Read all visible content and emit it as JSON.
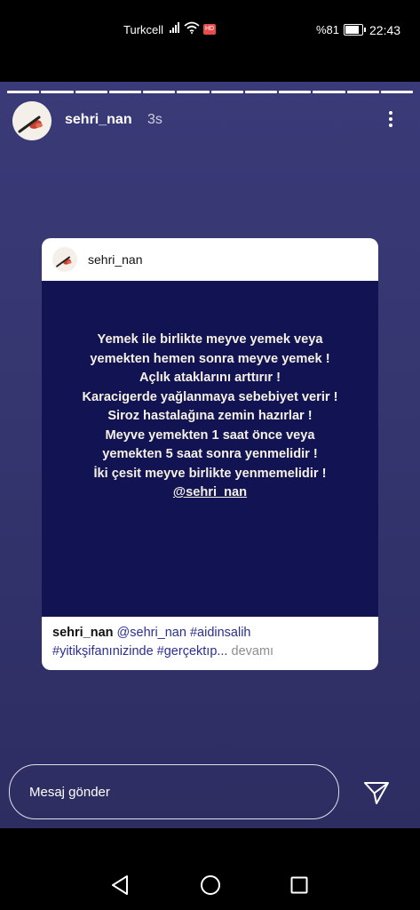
{
  "status_bar": {
    "carrier": "Turkcell",
    "hd_badge": "HD",
    "battery_percent": "%81",
    "battery_level": 0.81,
    "time": "22:43"
  },
  "story": {
    "progress_segments": 12,
    "username": "sehri_nan",
    "age": "3s",
    "shared_post": {
      "username": "sehri_nan",
      "text_lines": [
        "Yemek ile birlikte meyve yemek veya",
        "yemekten hemen sonra meyve yemek !",
        "Açlık ataklarını arttırır !",
        "Karacigerde yağlanmaya sebebiyet verir !",
        "Siroz hastalağına zemin hazırlar !",
        "Meyve yemekten 1 saat önce veya",
        "yemekten 5 saat sonra yenmelidir !",
        "İki çesit meyve birlikte yenmemelidir !"
      ],
      "mention": "@sehri_nan",
      "caption": {
        "username": "sehri_nan",
        "line1_tags": "@sehri_nan #aidinsalih",
        "line2_tags": "#yitikşifanınizinde #gerçektıp...",
        "more_label": "devamı"
      }
    },
    "reply": {
      "placeholder": "Mesaj gönder"
    }
  },
  "icons": {
    "signal": "signal-icon",
    "wifi": "wifi-icon",
    "battery": "battery-icon",
    "more": "more-vertical-icon",
    "send": "send-icon",
    "nav_back": "back-triangle-icon",
    "nav_home": "home-circle-icon",
    "nav_recent": "recent-square-icon"
  },
  "colors": {
    "story_background": "#34346e",
    "post_background": "#121352",
    "post_text": "#f5f1e6",
    "hashtag": "#2b2f8f"
  }
}
